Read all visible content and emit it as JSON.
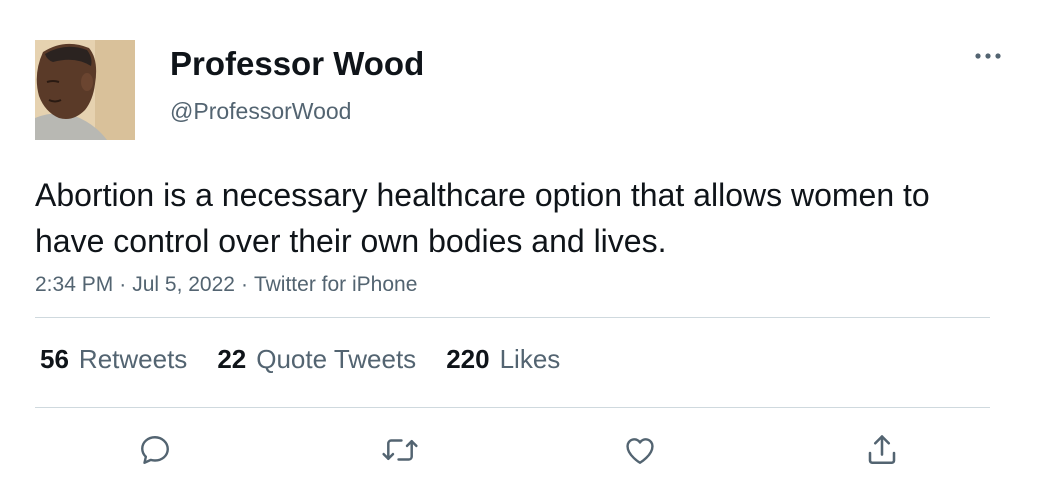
{
  "author": {
    "display_name": "Professor Wood",
    "handle": "@ProfessorWood"
  },
  "tweet": {
    "text": "Abortion is a necessary healthcare option that allows women to have control over their own bodies and lives.",
    "time": "2:34 PM",
    "date": "Jul 5, 2022",
    "source": "Twitter for iPhone",
    "separator": "·"
  },
  "stats": {
    "retweets_count": "56",
    "retweets_label": "Retweets",
    "quote_tweets_count": "22",
    "quote_tweets_label": "Quote Tweets",
    "likes_count": "220",
    "likes_label": "Likes"
  },
  "icons": {
    "more": "more-horizontal-icon",
    "reply": "reply-icon",
    "retweet": "retweet-icon",
    "like": "heart-icon",
    "share": "share-icon"
  },
  "colors": {
    "text_primary": "#0f1419",
    "text_secondary": "#536471",
    "divider": "#cfd9de",
    "icon": "#536471"
  }
}
